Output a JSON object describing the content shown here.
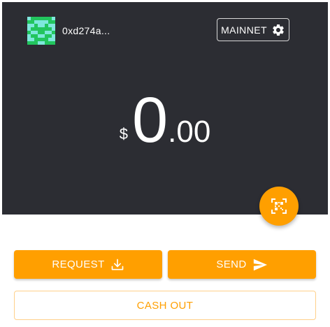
{
  "account": {
    "address": "0xd274a...",
    "avatar_icon": "identicon-icon"
  },
  "network": {
    "label": "MAINNET",
    "icon": "gear-icon"
  },
  "balance": {
    "currency_symbol": "$",
    "integer": "0",
    "decimal": ".00"
  },
  "scan": {
    "icon": "qr-code-icon"
  },
  "actions": {
    "request_label": "REQUEST",
    "request_icon": "download-icon",
    "send_label": "SEND",
    "send_icon": "send-icon",
    "cashout_label": "CASH OUT"
  },
  "colors": {
    "header_bg": "#2c2d33",
    "accent": "#ff9f00",
    "identicon_light": "#7ee8dc",
    "identicon_dark": "#22c55e"
  }
}
